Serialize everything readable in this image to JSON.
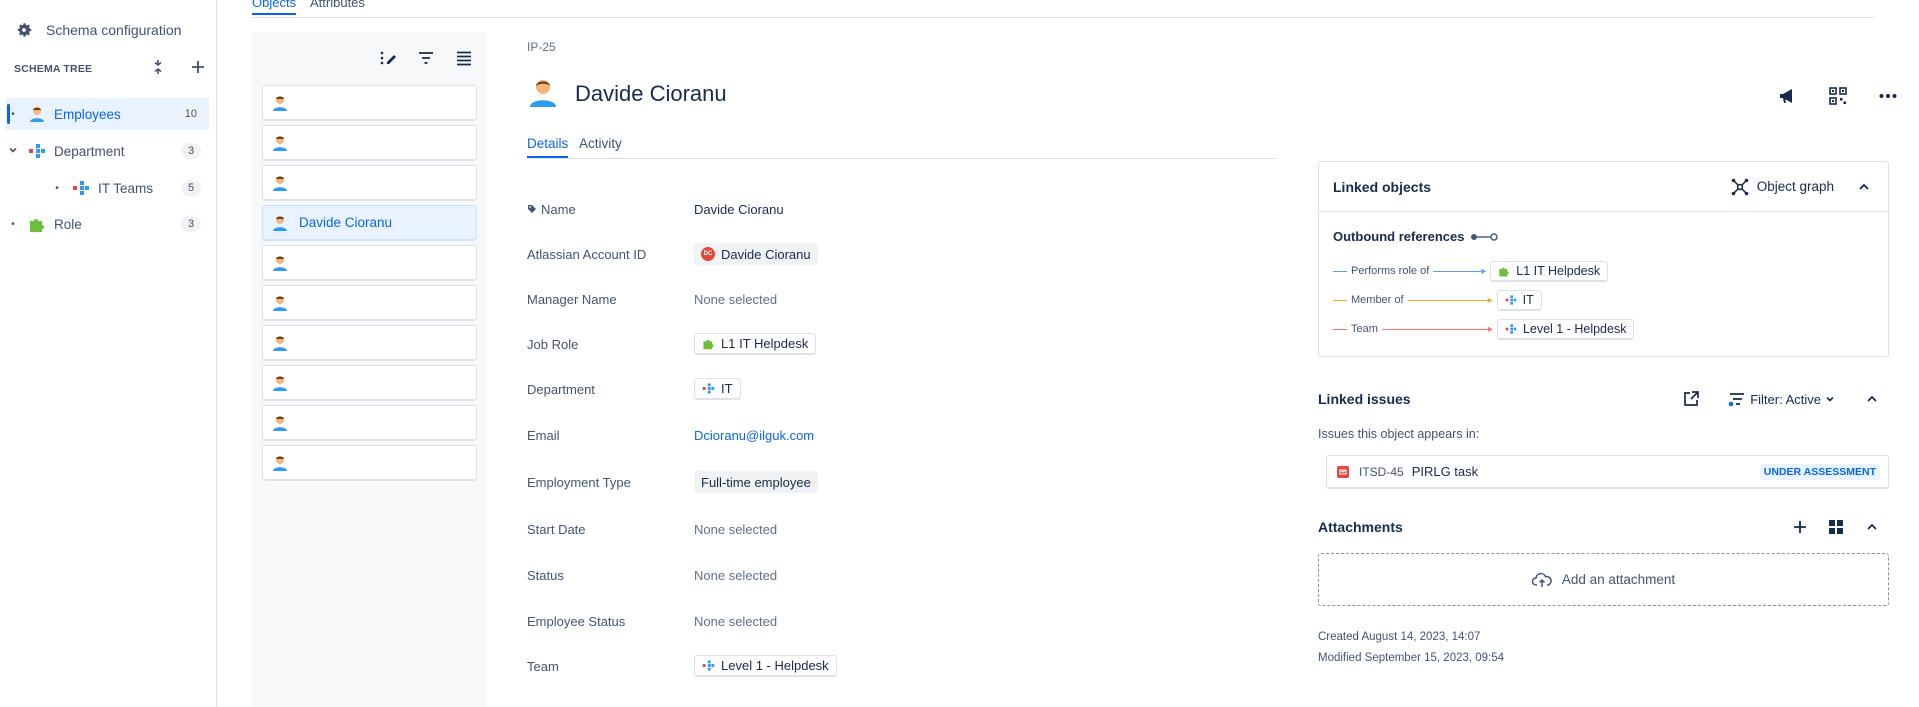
{
  "sidebar": {
    "schema_config": "Schema configuration",
    "tree_title": "SCHEMA TREE",
    "items": [
      {
        "label": "Employees",
        "count": "10"
      },
      {
        "label": "Department",
        "count": "3"
      },
      {
        "label": "IT Teams",
        "count": "5"
      },
      {
        "label": "Role",
        "count": "3"
      }
    ]
  },
  "top_tabs": {
    "objects": "Objects",
    "attributes": "Attributes"
  },
  "object_list": {
    "items": [
      "",
      "",
      "",
      "Davide Cioranu",
      "",
      "",
      "",
      "",
      "",
      ""
    ],
    "selected_index": 3
  },
  "object": {
    "key": "IP-25",
    "name": "Davide Cioranu",
    "tabs": {
      "details": "Details",
      "activity": "Activity"
    },
    "attributes": [
      {
        "label": "Name",
        "value": "Davide Cioranu"
      },
      {
        "label": "Atlassian Account ID",
        "value": "Davide Cioranu",
        "badge": "DC"
      },
      {
        "label": "Manager Name",
        "value": "None selected"
      },
      {
        "label": "Job Role",
        "value": "L1 IT Helpdesk"
      },
      {
        "label": "Department",
        "value": "IT"
      },
      {
        "label": "Email",
        "value": "Dcioranu@ilguk.com"
      },
      {
        "label": "Employment Type",
        "value": "Full-time employee"
      },
      {
        "label": "Start Date",
        "value": "None selected"
      },
      {
        "label": "Status",
        "value": "None selected"
      },
      {
        "label": "Employee Status",
        "value": "None selected"
      },
      {
        "label": "Team",
        "value": "Level 1 - Helpdesk"
      }
    ]
  },
  "linked_objects": {
    "title": "Linked objects",
    "graph_label": "Object graph",
    "outbound_label": "Outbound references",
    "refs": [
      {
        "relation": "Performs role of",
        "target": "L1 IT Helpdesk",
        "color": "#579dff"
      },
      {
        "relation": "Member of",
        "target": "IT",
        "color": "#f5a623"
      },
      {
        "relation": "Team",
        "target": "Level 1 - Helpdesk",
        "color": "#f87462"
      }
    ]
  },
  "linked_issues": {
    "title": "Linked issues",
    "filter_label": "Filter: Active",
    "subtitle": "Issues this object appears in:",
    "issue": {
      "key": "ITSD-45",
      "summary": "PIRLG task",
      "status": "UNDER ASSESSMENT"
    }
  },
  "attachments": {
    "title": "Attachments",
    "add_label": "Add an attachment"
  },
  "meta": {
    "created": "Created August 14, 2023, 14:07",
    "modified": "Modified September 15, 2023, 09:54"
  },
  "colors": {
    "accent": "#0c66e4",
    "role": "#6bbf3a",
    "department": "#e2483d",
    "issue": "#e2483d"
  }
}
